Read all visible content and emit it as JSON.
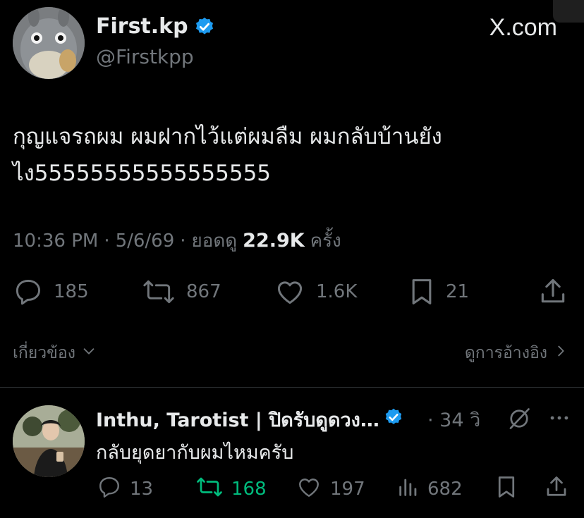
{
  "tweet": {
    "author_name": "First.kp",
    "handle": "@Firstkpp",
    "brand": "X.com",
    "text_line1": "กุญแจรถผม ผมฝากไว้แต่ผมลืม ผมกลับบ้านยัง",
    "text_line2": "ไง55555555555555555",
    "time": "10:36 PM",
    "sep1": "·",
    "date": "5/6/69",
    "sep2": "·",
    "views_label": "ยอดดู",
    "views_count": "22.9K",
    "views_suffix": "ครั้ง",
    "replies": "185",
    "retweets": "867",
    "likes": "1.6K",
    "bookmarks": "21",
    "related_label": "เกี่ยวข้อง",
    "quotes_label": "ดูการอ้างอิง"
  },
  "reply": {
    "author_name": "Inthu, Tarotist | ปิดรับดูดวง…",
    "time": "· 34 วิ",
    "text": "กลับยุดยากับผมไหมครับ",
    "replies": "13",
    "retweets": "168",
    "likes": "197",
    "views": "682"
  },
  "colors": {
    "background": "#000000",
    "text_primary": "#e7e9ea",
    "text_secondary": "#71767b",
    "verified_blue": "#1d9bf0",
    "retweet_green": "#00ba7c",
    "divider": "#2f3336"
  },
  "icons": [
    "verified-badge-icon",
    "x-logo-icon",
    "reply-icon",
    "retweet-icon",
    "like-icon",
    "bookmark-icon",
    "share-icon",
    "chevron-down-icon",
    "chevron-right-icon",
    "grok-icon",
    "more-icon",
    "views-icon"
  ]
}
